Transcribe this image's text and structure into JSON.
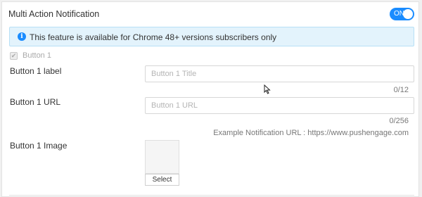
{
  "section": {
    "title": "Multi Action Notification",
    "toggle": {
      "label": "ON",
      "state": "on"
    }
  },
  "info_banner": {
    "icon": "info-icon",
    "icon_glyph": "i",
    "text": "This feature is available for Chrome 48+ versions subscribers only"
  },
  "button1": {
    "checkbox_label": "Button 1",
    "checkbox_checked": true,
    "checkbox_disabled": true,
    "label_field": {
      "label": "Button 1 label",
      "placeholder": "Button 1 Title",
      "value": "",
      "counter": "0/12"
    },
    "url_field": {
      "label": "Button 1 URL",
      "placeholder": "Button 1 URL",
      "value": "",
      "counter": "0/256",
      "example": "Example Notification URL : https://www.pushengage.com"
    },
    "image_field": {
      "label": "Button 1 Image",
      "select_label": "Select"
    }
  },
  "colors": {
    "accent": "#1a8cff",
    "banner_bg": "#e3f3fc",
    "banner_border": "#b7e0f6"
  }
}
